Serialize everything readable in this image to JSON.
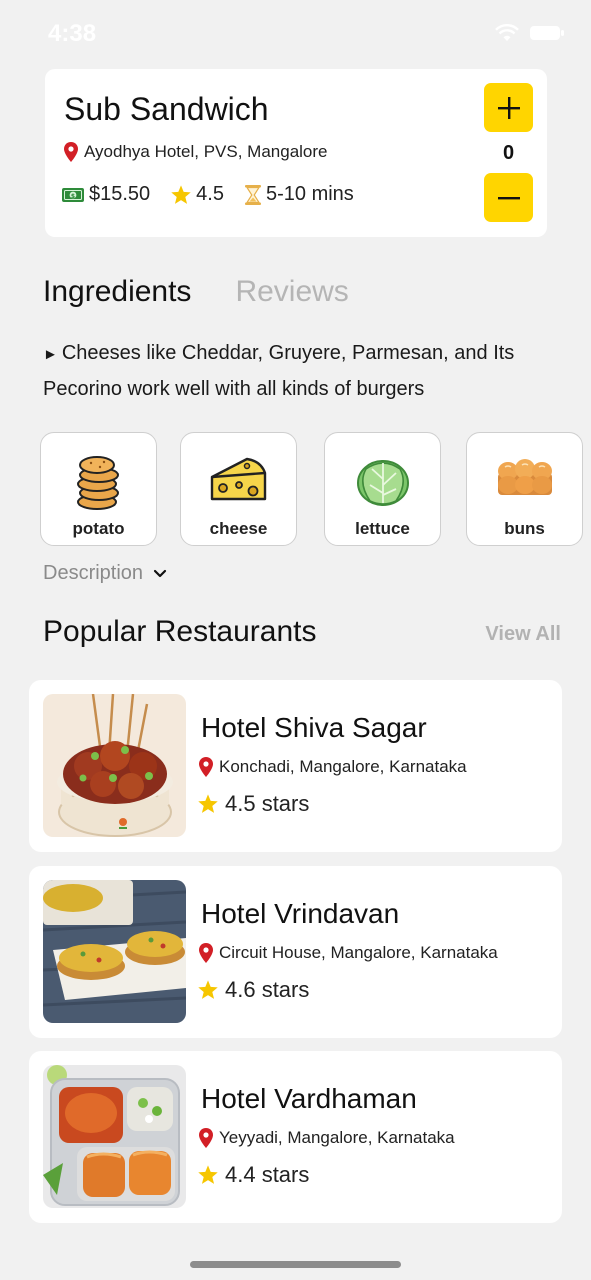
{
  "status": {
    "time": "4:38"
  },
  "product": {
    "title": "Sub Sandwich",
    "location": "Ayodhya Hotel, PVS, Mangalore",
    "price": "$15.50",
    "rating": "4.5",
    "time": "5-10 mins",
    "quantity": "0"
  },
  "tabs": {
    "ingredients": "Ingredients",
    "reviews": "Reviews"
  },
  "ingredients": {
    "text": "Cheeses like Cheddar, Gruyere, Parmesan, and Its Pecorino work well with all kinds of burgers",
    "items": [
      {
        "label": "potato",
        "icon": "potato-icon"
      },
      {
        "label": "cheese",
        "icon": "cheese-icon"
      },
      {
        "label": "lettuce",
        "icon": "lettuce-icon"
      },
      {
        "label": "buns",
        "icon": "buns-icon"
      }
    ],
    "description_label": "Description"
  },
  "popular": {
    "title": "Popular Restaurants",
    "view_all": "View All",
    "restaurants": [
      {
        "name": "Hotel Shiva Sagar",
        "location": "Konchadi, Mangalore, Karnataka",
        "rating": "4.5 stars"
      },
      {
        "name": "Hotel Vrindavan",
        "location": "Circuit House, Mangalore, Karnataka",
        "rating": "4.6 stars"
      },
      {
        "name": "Hotel Vardhaman",
        "location": "Yeyyadi, Mangalore, Karnataka",
        "rating": "4.4 stars"
      }
    ]
  },
  "colors": {
    "accent": "#ffd500",
    "pin": "#d21f26",
    "star": "#f6c600",
    "background": "#f1f1f1"
  }
}
